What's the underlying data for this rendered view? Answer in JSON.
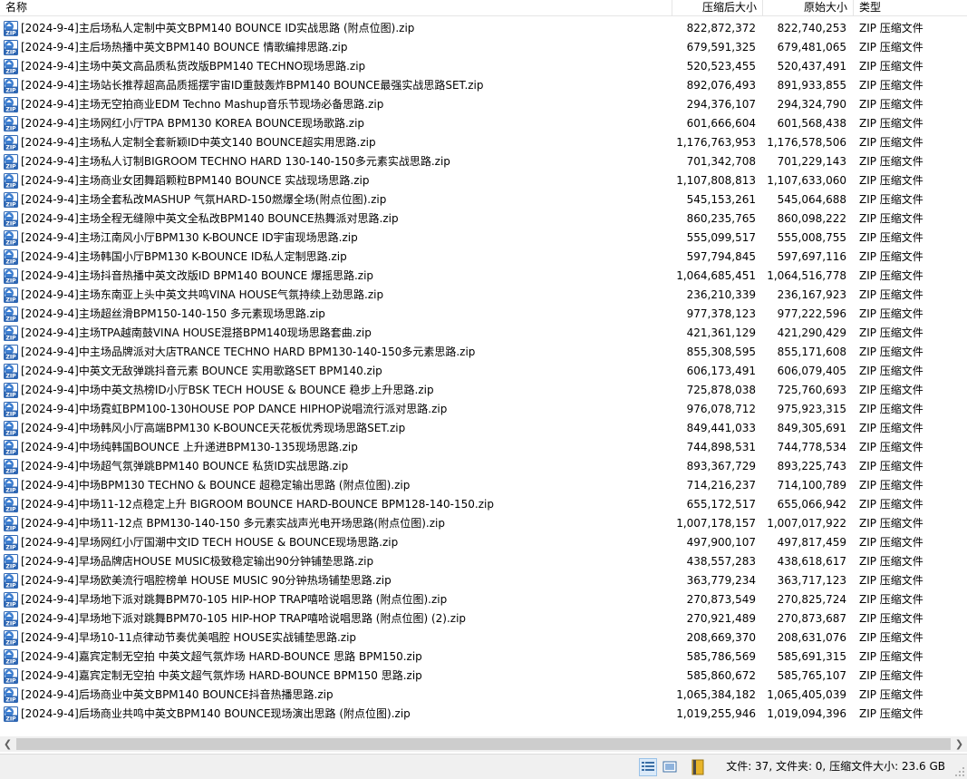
{
  "columns": {
    "name": "名称",
    "packed_size": "压缩后大小",
    "original_size": "原始大小",
    "type": "类型"
  },
  "icons": {
    "file": "zip-file-icon",
    "details_view": "details-view-icon",
    "large_icons_view": "large-icons-view-icon",
    "archive": "archive-book-icon"
  },
  "colors": {
    "zip_icon_blue": "#2f67b3",
    "archive_yellow": "#e8b52a"
  },
  "files": [
    {
      "name": "[2024-9-4]主后场私人定制中英文BPM140 BOUNCE ID实战思路 (附点位图).zip",
      "packed": "822,872,372",
      "size": "822,740,253",
      "type": "ZIP 压缩文件"
    },
    {
      "name": "[2024-9-4]主后场热播中英文BPM140 BOUNCE 情歌编排思路.zip",
      "packed": "679,591,325",
      "size": "679,481,065",
      "type": "ZIP 压缩文件"
    },
    {
      "name": "[2024-9-4]主场中英文高品质私货改版BPM140 TECHNO现场思路.zip",
      "packed": "520,523,455",
      "size": "520,437,491",
      "type": "ZIP 压缩文件"
    },
    {
      "name": "[2024-9-4]主场站长推荐超高品质摇摆宇宙ID重鼓轰炸BPM140 BOUNCE最强实战思路SET.zip",
      "packed": "892,076,493",
      "size": "891,933,855",
      "type": "ZIP 压缩文件"
    },
    {
      "name": "[2024-9-4]主场无空拍商业EDM Techno Mashup音乐节现场必备思路.zip",
      "packed": "294,376,107",
      "size": "294,324,790",
      "type": "ZIP 压缩文件"
    },
    {
      "name": "[2024-9-4]主场网红小厅TPA BPM130 KOREA BOUNCE现场歌路.zip",
      "packed": "601,666,604",
      "size": "601,568,438",
      "type": "ZIP 压缩文件"
    },
    {
      "name": "[2024-9-4]主场私人定制全套新颖ID中英文140 BOUNCE超实用思路.zip",
      "packed": "1,176,763,953",
      "size": "1,176,578,506",
      "type": "ZIP 压缩文件"
    },
    {
      "name": "[2024-9-4]主场私人订制BIGROOM TECHNO HARD 130-140-150多元素实战思路.zip",
      "packed": "701,342,708",
      "size": "701,229,143",
      "type": "ZIP 压缩文件"
    },
    {
      "name": "[2024-9-4]主场商业女团舞蹈颗粒BPM140 BOUNCE 实战现场思路.zip",
      "packed": "1,107,808,813",
      "size": "1,107,633,060",
      "type": "ZIP 压缩文件"
    },
    {
      "name": "[2024-9-4]主场全套私改MASHUP 气氛HARD-150燃爆全场(附点位图).zip",
      "packed": "545,153,261",
      "size": "545,064,688",
      "type": "ZIP 压缩文件"
    },
    {
      "name": "[2024-9-4]主场全程无缝隙中英文全私改BPM140 BOUNCE热舞派对思路.zip",
      "packed": "860,235,765",
      "size": "860,098,222",
      "type": "ZIP 压缩文件"
    },
    {
      "name": "[2024-9-4]主场江南风小厅BPM130 K-BOUNCE ID宇宙现场思路.zip",
      "packed": "555,099,517",
      "size": "555,008,755",
      "type": "ZIP 压缩文件"
    },
    {
      "name": "[2024-9-4]主场韩国小厅BPM130 K-BOUNCE ID私人定制思路.zip",
      "packed": "597,794,845",
      "size": "597,697,116",
      "type": "ZIP 压缩文件"
    },
    {
      "name": "[2024-9-4]主场抖音热播中英文改版ID BPM140 BOUNCE 爆摇思路.zip",
      "packed": "1,064,685,451",
      "size": "1,064,516,778",
      "type": "ZIP 压缩文件"
    },
    {
      "name": "[2024-9-4]主场东南亚上头中英文共鸣VINA HOUSE气氛持续上劲思路.zip",
      "packed": "236,210,339",
      "size": "236,167,923",
      "type": "ZIP 压缩文件"
    },
    {
      "name": "[2024-9-4]主场超丝滑BPM150-140-150 多元素现场思路.zip",
      "packed": "977,378,123",
      "size": "977,222,596",
      "type": "ZIP 压缩文件"
    },
    {
      "name": "[2024-9-4]主场TPA越南鼓VINA HOUSE混搭BPM140现场思路套曲.zip",
      "packed": "421,361,129",
      "size": "421,290,429",
      "type": "ZIP 压缩文件"
    },
    {
      "name": "[2024-9-4]中主场品牌派对大店TRANCE TECHNO HARD BPM130-140-150多元素思路.zip",
      "packed": "855,308,595",
      "size": "855,171,608",
      "type": "ZIP 压缩文件"
    },
    {
      "name": "[2024-9-4]中英文无敌弹跳抖音元素 BOUNCE 实用歌路SET BPM140.zip",
      "packed": "606,173,491",
      "size": "606,079,405",
      "type": "ZIP 压缩文件"
    },
    {
      "name": "[2024-9-4]中场中英文热榜ID小厅BSK TECH HOUSE & BOUNCE 稳步上升思路.zip",
      "packed": "725,878,038",
      "size": "725,760,693",
      "type": "ZIP 压缩文件"
    },
    {
      "name": "[2024-9-4]中场霓虹BPM100-130HOUSE POP DANCE HIPHOP说唱流行派对思路.zip",
      "packed": "976,078,712",
      "size": "975,923,315",
      "type": "ZIP 压缩文件"
    },
    {
      "name": "[2024-9-4]中场韩风小厅高端BPM130 K-BOUNCE天花板优秀现场思路SET.zip",
      "packed": "849,441,033",
      "size": "849,305,691",
      "type": "ZIP 压缩文件"
    },
    {
      "name": "[2024-9-4]中场纯韩国BOUNCE 上升递进BPM130-135现场思路.zip",
      "packed": "744,898,531",
      "size": "744,778,534",
      "type": "ZIP 压缩文件"
    },
    {
      "name": "[2024-9-4]中场超气氛弹跳BPM140 BOUNCE 私货ID实战思路.zip",
      "packed": "893,367,729",
      "size": "893,225,743",
      "type": "ZIP 压缩文件"
    },
    {
      "name": "[2024-9-4]中场BPM130 TECHNO & BOUNCE 超稳定输出思路  (附点位图).zip",
      "packed": "714,216,237",
      "size": "714,100,789",
      "type": "ZIP 压缩文件"
    },
    {
      "name": "[2024-9-4]中场11-12点稳定上升 BIGROOM BOUNCE HARD-BOUNCE BPM128-140-150.zip",
      "packed": "655,172,517",
      "size": "655,066,942",
      "type": "ZIP 压缩文件"
    },
    {
      "name": "[2024-9-4]中场11-12点 BPM130-140-150 多元素实战声光电开场思路(附点位图).zip",
      "packed": "1,007,178,157",
      "size": "1,007,017,922",
      "type": "ZIP 压缩文件"
    },
    {
      "name": "[2024-9-4]早场网红小厅国潮中文ID TECH HOUSE & BOUNCE现场思路.zip",
      "packed": "497,900,107",
      "size": "497,817,459",
      "type": "ZIP 压缩文件"
    },
    {
      "name": "[2024-9-4]早场品牌店HOUSE MUSIC极致稳定输出90分钟铺垫思路.zip",
      "packed": "438,557,283",
      "size": "438,618,617",
      "type": "ZIP 压缩文件"
    },
    {
      "name": "[2024-9-4]早场欧美流行唱腔榜单 HOUSE MUSIC 90分钟热场铺垫思路.zip",
      "packed": "363,779,234",
      "size": "363,717,123",
      "type": "ZIP 压缩文件"
    },
    {
      "name": "[2024-9-4]早场地下派对跳舞BPM70-105 HIP-HOP TRAP嘻哈说唱思路 (附点位图).zip",
      "packed": "270,873,549",
      "size": "270,825,724",
      "type": "ZIP 压缩文件"
    },
    {
      "name": "[2024-9-4]早场地下派对跳舞BPM70-105 HIP-HOP TRAP嘻哈说唱思路 (附点位图) (2).zip",
      "packed": "270,921,489",
      "size": "270,873,687",
      "type": "ZIP 压缩文件"
    },
    {
      "name": "[2024-9-4]早场10-11点律动节奏优美唱腔 HOUSE实战铺垫思路.zip",
      "packed": "208,669,370",
      "size": "208,631,076",
      "type": "ZIP 压缩文件"
    },
    {
      "name": "[2024-9-4]嘉宾定制无空拍 中英文超气氛炸场 HARD-BOUNCE 思路 BPM150.zip",
      "packed": "585,786,569",
      "size": "585,691,315",
      "type": "ZIP 压缩文件"
    },
    {
      "name": "[2024-9-4]嘉宾定制无空拍 中英文超气氛炸场 HARD-BOUNCE  BPM150 思路.zip",
      "packed": "585,860,672",
      "size": "585,765,107",
      "type": "ZIP 压缩文件"
    },
    {
      "name": "[2024-9-4]后场商业中英文BPM140 BOUNCE抖音热播思路.zip",
      "packed": "1,065,384,182",
      "size": "1,065,405,039",
      "type": "ZIP 压缩文件"
    },
    {
      "name": "[2024-9-4]后场商业共鸣中英文BPM140 BOUNCE现场演出思路 (附点位图).zip",
      "packed": "1,019,255,946",
      "size": "1,019,094,396",
      "type": "ZIP 压缩文件"
    }
  ],
  "status": {
    "summary": "文件: 37, 文件夹: 0, 压缩文件大小: 23.6 GB"
  }
}
